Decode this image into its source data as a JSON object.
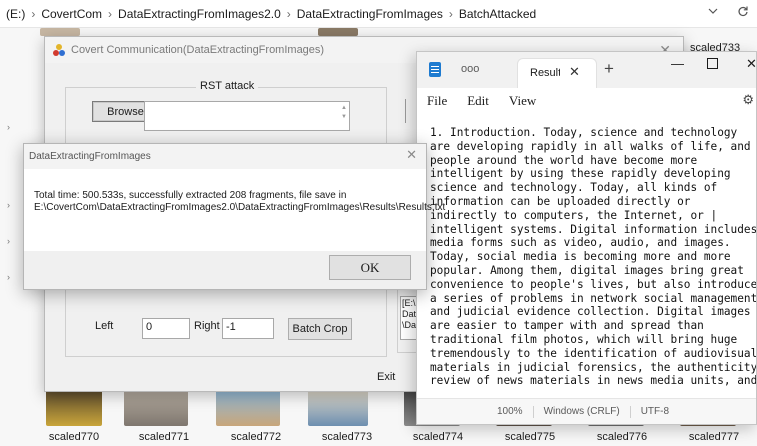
{
  "breadcrumb": {
    "drive": "(E:)",
    "items": [
      "CovertCom",
      "DataExtractingFromImages2.0",
      "DataExtractingFromImages",
      "BatchAttacked"
    ],
    "separator": "›"
  },
  "explorer": {
    "dropdown_icon": "chevron-down-icon",
    "refresh_icon": "refresh-icon",
    "top_right_label": "scaled733",
    "thumbnails": [
      "scaled770",
      "scaled771",
      "scaled772",
      "scaled773",
      "scaled774",
      "scaled775",
      "scaled776",
      "scaled777"
    ]
  },
  "main_window": {
    "title": "Covert Communication(DataExtractingFromImages)",
    "group_label": "RST attack",
    "browse_label": "Browse",
    "left_label": "Left",
    "left_value": "0",
    "right_label": "Right",
    "right_value": "-1",
    "batch_crop_label": "Batch Crop",
    "exit_label": "Exit",
    "side_partial_text": "[E:\\\nDat\n\\Da"
  },
  "notepad": {
    "inactive_tab_title": "ooo",
    "active_tab_title": "Result",
    "menu": [
      "File",
      "Edit",
      "View"
    ],
    "text": "1. Introduction. Today, science and technology\nare developing rapidly in all walks of life, and\npeople around the world have become more\nintelligent by using these rapidly developing\nscience and technology. Today, all kinds of\ninformation can be uploaded directly or\nindirectly to computers, the Internet, or |\nintelligent systems. Digital information includes\nmedia forms such as video, audio, and images.\nToday, social media is becoming more and more\npopular. Among them, digital images bring great\nconvenience to people's lives, but also introduce\na series of problems in network social management\nand judicial evidence collection. Digital images\nare easier to tamper with and spread than\ntraditional film photos, which will bring huge\ntremendously to the identification of audiovisual\nmaterials in judicial forensics, the authenticity\nreview of news materials in news media units, and",
    "status": {
      "zoom": "100%",
      "line_ending": "Windows (CRLF)",
      "encoding": "UTF-8"
    }
  },
  "dialog": {
    "title": "DataExtractingFromImages",
    "message": "Total time: 500.533s, successfully extracted 208 fragments, file save in E:\\CovertCom\\DataExtractingFromImages2.0\\DataExtractingFromImages\\Results\\Results.txt",
    "ok_label": "OK"
  },
  "colors": {
    "notepad_icon": "#1e7bd0",
    "dialog_bg": "#f0f0f0",
    "button_bg": "#e1e1e1"
  }
}
